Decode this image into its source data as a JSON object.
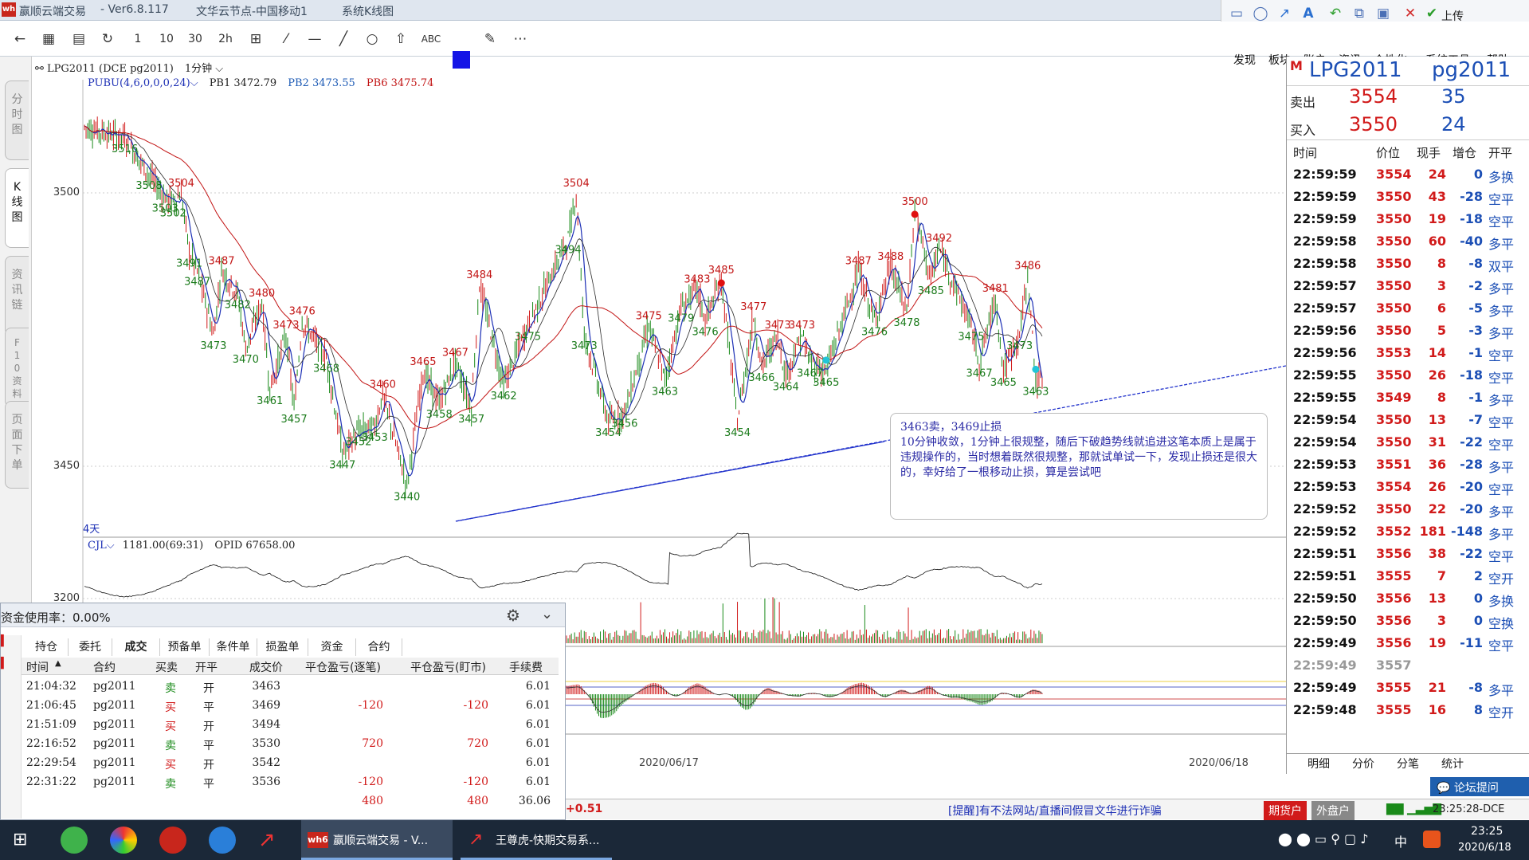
{
  "window": {
    "title": "赢顺云端交易",
    "version": "- Ver6.8.117",
    "node": "文华云节点-中国移动1",
    "view": "系统K线图"
  },
  "toolbar_right": {
    "upload": "上传",
    "menus": [
      "发现",
      "板块",
      "账户",
      "资讯",
      "个性化",
      "系统工具",
      "帮助"
    ]
  },
  "left_nav": [
    "分时图",
    "K线图",
    "资讯链",
    "F10资料",
    "页面下单"
  ],
  "chart": {
    "header": "LPG2011 (DCE pg2011)",
    "period": "1分钟",
    "indicator": "PUBU(4,6,0,0,0,24)",
    "pb1": "PB1 3472.79",
    "pb2": "PB2 3473.55",
    "pb6": "PB6 3475.74",
    "period_tag": "4天",
    "annotation": {
      "title": "3463卖，3469止损",
      "text": "10分钟收敛，1分钟上很规整，随后下破趋势线就追进这笔本质上是属于违规操作的，当时想着既然很规整，那就试单试一下，发现止损还是很大的，幸好给了一根移动止损，算是尝试吧"
    },
    "volume_header": "CJL",
    "volume_value": "1181.00(69:31)",
    "opid": "OPID 67658.00",
    "dates": [
      "2020/06/17",
      "2020/06/18"
    ]
  },
  "chart_data": {
    "type": "candlestick",
    "y_ticks_price": [
      3500,
      3450
    ],
    "y_ticks_volume": [
      3200
    ],
    "ylim_price": [
      3438,
      3520
    ],
    "price_labels": [
      {
        "v": 3516,
        "i": 5
      },
      {
        "v": 3508,
        "i": 8
      },
      {
        "v": 3503,
        "i": 10
      },
      {
        "v": 3502,
        "i": 11
      },
      {
        "v": 3504,
        "i": 12
      },
      {
        "v": 3491,
        "i": 13
      },
      {
        "v": 3487,
        "i": 14
      },
      {
        "v": 3473,
        "i": 16
      },
      {
        "v": 3487,
        "i": 17
      },
      {
        "v": 3482,
        "i": 19
      },
      {
        "v": 3470,
        "i": 20
      },
      {
        "v": 3480,
        "i": 22
      },
      {
        "v": 3461,
        "i": 23
      },
      {
        "v": 3473,
        "i": 25
      },
      {
        "v": 3476,
        "i": 27
      },
      {
        "v": 3457,
        "i": 26
      },
      {
        "v": 3468,
        "i": 30
      },
      {
        "v": 3447,
        "i": 32
      },
      {
        "v": 3452,
        "i": 34
      },
      {
        "v": 3453,
        "i": 36
      },
      {
        "v": 3460,
        "i": 37
      },
      {
        "v": 3440,
        "i": 40
      },
      {
        "v": 3465,
        "i": 42
      },
      {
        "v": 3458,
        "i": 44
      },
      {
        "v": 3467,
        "i": 46
      },
      {
        "v": 3457,
        "i": 48
      },
      {
        "v": 3484,
        "i": 49
      },
      {
        "v": 3462,
        "i": 52
      },
      {
        "v": 3475,
        "i": 55
      },
      {
        "v": 3494,
        "i": 60
      },
      {
        "v": 3504,
        "i": 61
      },
      {
        "v": 3473,
        "i": 62
      },
      {
        "v": 3454,
        "i": 65
      },
      {
        "v": 3456,
        "i": 67
      },
      {
        "v": 3475,
        "i": 70
      },
      {
        "v": 3463,
        "i": 72
      },
      {
        "v": 3479,
        "i": 74
      },
      {
        "v": 3483,
        "i": 76
      },
      {
        "v": 3476,
        "i": 77
      },
      {
        "v": 3485,
        "i": 79
      },
      {
        "v": 3454,
        "i": 81
      },
      {
        "v": 3477,
        "i": 83
      },
      {
        "v": 3466,
        "i": 84
      },
      {
        "v": 3473,
        "i": 86
      },
      {
        "v": 3464,
        "i": 87
      },
      {
        "v": 3473,
        "i": 89
      },
      {
        "v": 3467,
        "i": 90
      },
      {
        "v": 3465,
        "i": 92
      },
      {
        "v": 3487,
        "i": 96
      },
      {
        "v": 3476,
        "i": 98
      },
      {
        "v": 3488,
        "i": 100
      },
      {
        "v": 3478,
        "i": 102
      },
      {
        "v": 3500,
        "i": 103
      },
      {
        "v": 3485,
        "i": 105
      },
      {
        "v": 3492,
        "i": 106
      },
      {
        "v": 3475,
        "i": 110
      },
      {
        "v": 3467,
        "i": 111
      },
      {
        "v": 3481,
        "i": 113
      },
      {
        "v": 3465,
        "i": 114
      },
      {
        "v": 3473,
        "i": 116
      },
      {
        "v": 3486,
        "i": 117
      },
      {
        "v": 3463,
        "i": 118
      }
    ]
  },
  "quote": {
    "symbol": "LPG2011",
    "code": "pg2011",
    "sell_label": "卖出",
    "sell_price": "3554",
    "sell_vol": "35",
    "buy_label": "买入",
    "buy_price": "3550",
    "buy_vol": "24",
    "cols": [
      "时间",
      "价位",
      "现手",
      "增仓",
      "开平"
    ],
    "ticks": [
      [
        "22:59:59",
        "3554",
        "24",
        "0",
        "多换"
      ],
      [
        "22:59:59",
        "3550",
        "43",
        "-28",
        "空平"
      ],
      [
        "22:59:59",
        "3550",
        "19",
        "-18",
        "空平"
      ],
      [
        "22:59:58",
        "3550",
        "60",
        "-40",
        "多平"
      ],
      [
        "22:59:58",
        "3550",
        "8",
        "-8",
        "双平"
      ],
      [
        "22:59:57",
        "3550",
        "3",
        "-2",
        "多平"
      ],
      [
        "22:59:57",
        "3550",
        "6",
        "-5",
        "多平"
      ],
      [
        "22:59:56",
        "3550",
        "5",
        "-3",
        "多平"
      ],
      [
        "22:59:56",
        "3553",
        "14",
        "-1",
        "空平"
      ],
      [
        "22:59:55",
        "3550",
        "26",
        "-18",
        "空平"
      ],
      [
        "22:59:55",
        "3549",
        "8",
        "-1",
        "多平"
      ],
      [
        "22:59:54",
        "3550",
        "13",
        "-7",
        "空平"
      ],
      [
        "22:59:54",
        "3550",
        "31",
        "-22",
        "空平"
      ],
      [
        "22:59:53",
        "3551",
        "36",
        "-28",
        "多平"
      ],
      [
        "22:59:53",
        "3554",
        "26",
        "-20",
        "空平"
      ],
      [
        "22:59:52",
        "3550",
        "22",
        "-20",
        "多平"
      ],
      [
        "22:59:52",
        "3552",
        "181",
        "-148",
        "多平"
      ],
      [
        "22:59:51",
        "3556",
        "38",
        "-22",
        "空平"
      ],
      [
        "22:59:51",
        "3555",
        "7",
        "2",
        "空开"
      ],
      [
        "22:59:50",
        "3556",
        "13",
        "0",
        "多换"
      ],
      [
        "22:59:50",
        "3556",
        "3",
        "0",
        "空换"
      ],
      [
        "22:59:49",
        "3556",
        "19",
        "-11",
        "空平"
      ],
      [
        "22:59:49",
        "3557",
        "",
        "",
        ""
      ],
      [
        "22:59:49",
        "3555",
        "21",
        "-8",
        "多平"
      ],
      [
        "22:59:48",
        "3555",
        "16",
        "8",
        "空开"
      ]
    ],
    "tabs": [
      "明细",
      "分价",
      "分笔",
      "统计"
    ],
    "forum": "论坛提问"
  },
  "trade": {
    "capital": "资金使用率：0.00%",
    "tabs": [
      "持仓",
      "委托",
      "成交",
      "预备单",
      "条件单",
      "损盈单",
      "资金",
      "合约"
    ],
    "cols": [
      "时间",
      "合约",
      "买卖",
      "开平",
      "成交价",
      "平仓盈亏(逐笔)",
      "平仓盈亏(盯市)",
      "手续费"
    ],
    "rows": [
      [
        "21:04:32",
        "pg2011",
        "卖",
        "开",
        "3463",
        "",
        "",
        "6.01"
      ],
      [
        "21:06:45",
        "pg2011",
        "买",
        "平",
        "3469",
        "-120",
        "-120",
        "6.01"
      ],
      [
        "21:51:09",
        "pg2011",
        "买",
        "开",
        "3494",
        "",
        "",
        "6.01"
      ],
      [
        "22:16:52",
        "pg2011",
        "卖",
        "平",
        "3530",
        "720",
        "720",
        "6.01"
      ],
      [
        "22:29:54",
        "pg2011",
        "买",
        "开",
        "3542",
        "",
        "",
        "6.01"
      ],
      [
        "22:31:22",
        "pg2011",
        "卖",
        "平",
        "3536",
        "-120",
        "-120",
        "6.01"
      ]
    ],
    "totals": [
      "480",
      "480",
      "36.06"
    ]
  },
  "status": {
    "change": "+0.51",
    "warning": "[提醒]有不法网站/直播间假冒文华进行诈骗",
    "btn1": "期货户",
    "btn2": "外盘户",
    "time": "23:25:28-DCE"
  },
  "taskbar": {
    "app1": "赢顺云端交易 - V...",
    "app2": "王尊虎-快期交易系...",
    "ime": "中",
    "clock_time": "23:25",
    "clock_date": "2020/6/18"
  },
  "colors": {
    "up": "#d11a1a",
    "down": "#1a8a1a",
    "ma_blue": "#1c2fb5",
    "ma_red": "#c21414",
    "trend": "#2233cc"
  }
}
